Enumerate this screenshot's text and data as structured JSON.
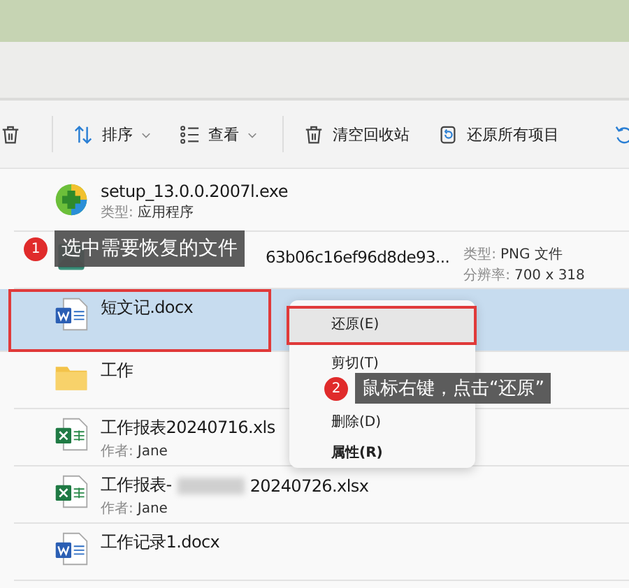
{
  "toolbar": [
    {
      "kind": "trash"
    },
    {
      "kind": "sort",
      "label": "排序",
      "dropdown": true
    },
    {
      "kind": "view",
      "label": "查看",
      "dropdown": true
    },
    {
      "kind": "trash",
      "label": "清空回收站"
    },
    {
      "kind": "restore-all",
      "label": "还原所有项目"
    },
    {
      "kind": "undo"
    }
  ],
  "files": [
    {
      "kind": "setup",
      "name": "setup_13.0.0.2007l.exe",
      "details": [
        {
          "label": "类型:",
          "value": "应用程序"
        }
      ],
      "selected": false
    },
    {
      "kind": "image",
      "name": "63b06c16ef96d8de93...",
      "side_details": [
        {
          "label": "类型:",
          "value": "PNG 文件"
        },
        {
          "label": "分辨率:",
          "value": "700 x 318"
        }
      ],
      "selected": false
    },
    {
      "kind": "word",
      "name": "短文记.docx",
      "selected": true
    },
    {
      "kind": "folder",
      "name": "工作",
      "selected": false
    },
    {
      "kind": "excel",
      "name": "工作报表20240716.xls",
      "details": [
        {
          "label": "作者:",
          "value": "Jane"
        }
      ],
      "selected": false
    },
    {
      "kind": "excel",
      "name": "工作报表-",
      "name_after_blur": "20240726.xlsx",
      "details": [
        {
          "label": "作者:",
          "value": "Jane"
        }
      ],
      "selected": false
    },
    {
      "kind": "word",
      "name": "工作记录1.docx",
      "selected": false
    }
  ],
  "context_menu": [
    {
      "label": "还原(E)",
      "highlighted": true,
      "bold": false
    },
    {
      "label": "剪切(T)",
      "highlighted": false,
      "bold": false
    },
    {
      "label": "删除(D)",
      "highlighted": false,
      "bold": false
    },
    {
      "label": "属性(R)",
      "highlighted": false,
      "bold": true
    }
  ],
  "steps": [
    {
      "number": "1",
      "text": "选中需要恢复的文件"
    },
    {
      "number": "2",
      "text": "鼠标右键，点击“还原”"
    }
  ]
}
